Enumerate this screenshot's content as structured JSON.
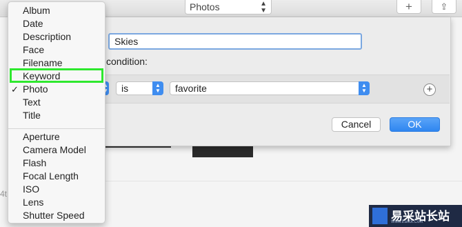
{
  "toolbar": {
    "source_popup": "Photos",
    "add_button": "+",
    "share_button": "⇪"
  },
  "background": {
    "partial_text": "4t"
  },
  "sheet": {
    "album_name": "Skies",
    "condition_label": "condition:",
    "rule": {
      "operator": "is",
      "value": "favorite"
    },
    "add_rule_button": "+",
    "cancel_label": "Cancel",
    "ok_label": "OK"
  },
  "menu": {
    "group1": [
      "Album",
      "Date",
      "Description",
      "Face",
      "Filename",
      "Keyword",
      "Photo",
      "Text",
      "Title"
    ],
    "checked_item": "Photo",
    "group2": [
      "Aperture",
      "Camera Model",
      "Flash",
      "Focal Length",
      "ISO",
      "Lens",
      "Shutter Speed"
    ],
    "highlighted_item": "Keyword"
  },
  "watermark": {
    "text": "易采站长站",
    "subtext": "Www.Easck.Com"
  },
  "colors": {
    "accent": "#3f8df0",
    "highlight_box": "#2ee82e"
  }
}
